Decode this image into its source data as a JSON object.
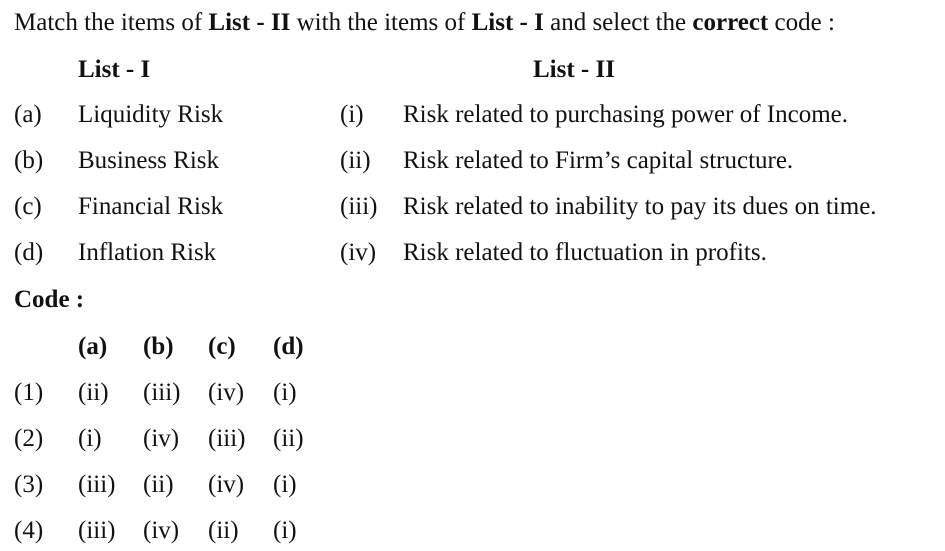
{
  "question": {
    "parts": [
      {
        "text": "Match the items of ",
        "bold": false
      },
      {
        "text": "List - II",
        "bold": true
      },
      {
        "text": " with the items of ",
        "bold": false
      },
      {
        "text": "List - I",
        "bold": true
      },
      {
        "text": " and select the ",
        "bold": false
      },
      {
        "text": "correct",
        "bold": true
      },
      {
        "text": " code :",
        "bold": false
      }
    ]
  },
  "list_headers": {
    "list1": "List - I",
    "list2": "List - II"
  },
  "rows": [
    {
      "l_label": "(a)",
      "l_text": "Liquidity Risk",
      "r_label": "(i)",
      "r_text": "Risk related to purchasing power of Income."
    },
    {
      "l_label": "(b)",
      "l_text": "Business Risk",
      "r_label": "(ii)",
      "r_text": "Risk related to Firm’s capital structure."
    },
    {
      "l_label": "(c)",
      "l_text": "Financial Risk",
      "r_label": "(iii)",
      "r_text": "Risk related to inability to pay its dues on time."
    },
    {
      "l_label": "(d)",
      "l_text": "Inflation Risk",
      "r_label": "(iv)",
      "r_text": "Risk related to fluctuation in profits."
    }
  ],
  "code": {
    "label": "Code :",
    "headers": [
      "(a)",
      "(b)",
      "(c)",
      "(d)"
    ],
    "options": [
      {
        "num": "(1)",
        "values": [
          "(ii)",
          "(iii)",
          "(iv)",
          "(i)"
        ]
      },
      {
        "num": "(2)",
        "values": [
          "(i)",
          "(iv)",
          "(iii)",
          "(ii)"
        ]
      },
      {
        "num": "(3)",
        "values": [
          "(iii)",
          "(ii)",
          "(iv)",
          "(i)"
        ]
      },
      {
        "num": "(4)",
        "values": [
          "(iii)",
          "(iv)",
          "(ii)",
          "(i)"
        ]
      }
    ]
  }
}
